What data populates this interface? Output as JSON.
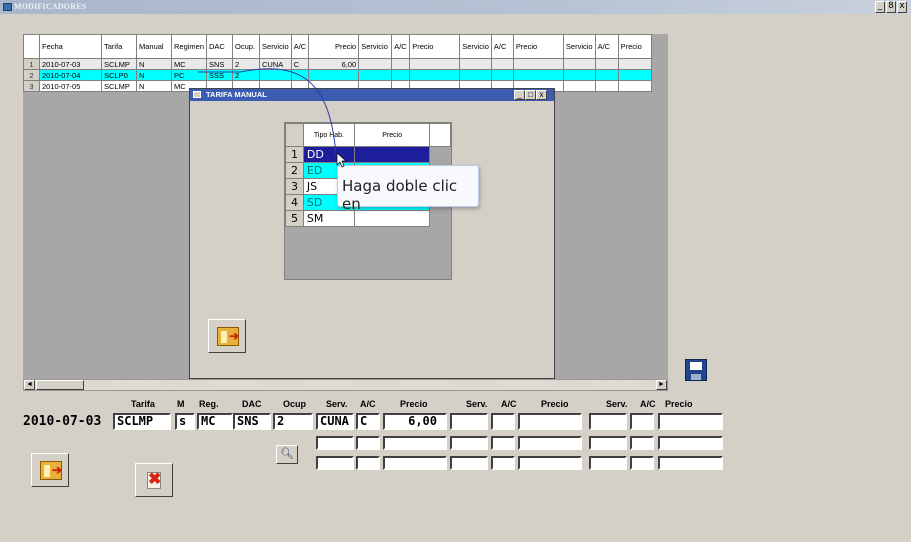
{
  "window": {
    "title": "MODIFICADORES",
    "controls": [
      "_",
      "8",
      "x"
    ]
  },
  "grid": {
    "headers": [
      "Fecha",
      "Tarifa",
      "Manual",
      "Regimen",
      "DAC",
      "Ocup.",
      "Servicio",
      "A/C",
      "Precio",
      "Servicio",
      "A/C",
      "Precio",
      "Servicio",
      "A/C",
      "Precio",
      "Servicio",
      "A/C",
      "Precio"
    ],
    "rows": [
      {
        "n": "1",
        "fecha": "2010-07-03",
        "tarifa": "SCLMP",
        "manual": "N",
        "regimen": "MC",
        "dac": "SNS",
        "ocup": "2",
        "servicio": "CUNA",
        "ac": "C",
        "precio": "6,00"
      },
      {
        "n": "2",
        "fecha": "2010-07-04",
        "tarifa": "SCLP0",
        "manual": "N",
        "regimen": "PC",
        "dac": "SSS",
        "ocup": "2",
        "servicio": "",
        "ac": "",
        "precio": ""
      },
      {
        "n": "3",
        "fecha": "2010-07-05",
        "tarifa": "SCLMP",
        "manual": "N",
        "regimen": "MC",
        "dac": "",
        "ocup": "",
        "servicio": "",
        "ac": "",
        "precio": ""
      }
    ]
  },
  "dialog": {
    "title": "TARIFA MANUAL",
    "controls": [
      "_",
      "□",
      "x"
    ],
    "headers": [
      "Tipo Hab.",
      "Precio"
    ],
    "rows": [
      {
        "n": "1",
        "tipo": "DD"
      },
      {
        "n": "2",
        "tipo": "ED"
      },
      {
        "n": "3",
        "tipo": "JS"
      },
      {
        "n": "4",
        "tipo": "SD"
      },
      {
        "n": "5",
        "tipo": "SM"
      }
    ]
  },
  "tooltip": {
    "text": "Haga doble clic en"
  },
  "scroll": {
    "left": "◄",
    "right": "►"
  },
  "form": {
    "labels": {
      "tarifa": "Tarifa",
      "m": "M",
      "reg": "Reg.",
      "dac": "DAC",
      "ocup": "Ocup",
      "serv1": "Serv.",
      "ac1": "A/C",
      "precio1": "Precio",
      "serv2": "Serv.",
      "ac2": "A/C",
      "precio2": "Precio",
      "serv3": "Serv.",
      "ac3": "A/C",
      "precio3": "Precio"
    },
    "values": {
      "fecha": "2010-07-03",
      "tarifa": "SCLMP",
      "m": "s",
      "reg": "MC",
      "dac": "SNS",
      "ocup": "2",
      "serv1": "CUNA",
      "ac1": "C",
      "precio1": "6,00"
    }
  },
  "icons": {
    "exit": "exit-icon",
    "save": "save-icon",
    "delete": "delete-icon",
    "search": "search-icon"
  },
  "colors": {
    "selection_cyan": "#00ffff",
    "selected_row": "#1e1e9a",
    "dialog_title": "#3b5cb0"
  }
}
